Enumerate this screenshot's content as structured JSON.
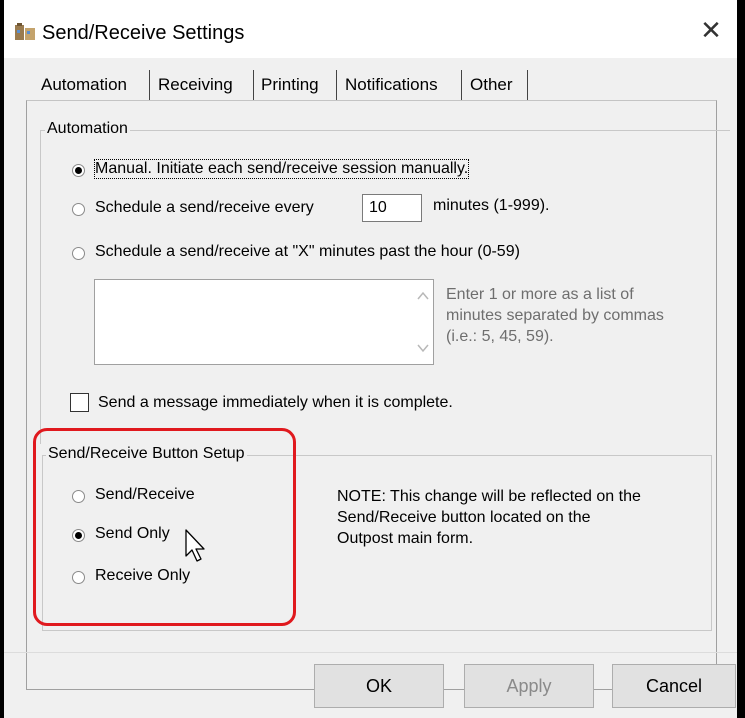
{
  "window": {
    "title": "Send/Receive Settings",
    "close_glyph": "✕"
  },
  "tabs": [
    {
      "label": "Automation"
    },
    {
      "label": "Receiving"
    },
    {
      "label": "Printing"
    },
    {
      "label": "Notifications"
    },
    {
      "label": "Other"
    }
  ],
  "automation": {
    "group_label": "Automation",
    "manual_label": "Manual.  Initiate each send/receive session manually.",
    "schedule_every_label": "Schedule a send/receive every",
    "minutes_value": "10",
    "minutes_range_label": "minutes (1-999).",
    "schedule_past_hour_label": "Schedule a send/receive at \"X\" minutes past the hour (0-59)",
    "list_help": [
      "Enter 1 or more as a list of",
      "minutes separated by commas",
      "(i.e.: 5, 45, 59)."
    ],
    "send_immediately_label": "Send a message immediately when it is complete.",
    "selected": "manual"
  },
  "button_setup": {
    "group_label": "Send/Receive Button Setup",
    "options": [
      {
        "label": "Send/Receive"
      },
      {
        "label": "Send Only"
      },
      {
        "label": "Receive Only"
      }
    ],
    "selected": "Send Only",
    "note_lines": [
      "NOTE:  This change will be reflected on the",
      "Send/Receive button located on the",
      "Outpost main form."
    ]
  },
  "buttons": {
    "ok": "OK",
    "apply": "Apply",
    "cancel": "Cancel"
  },
  "colors": {
    "highlight": "#e0191e",
    "dialog_bg": "#f0f0f0",
    "help_text": "#6e6e6e"
  }
}
